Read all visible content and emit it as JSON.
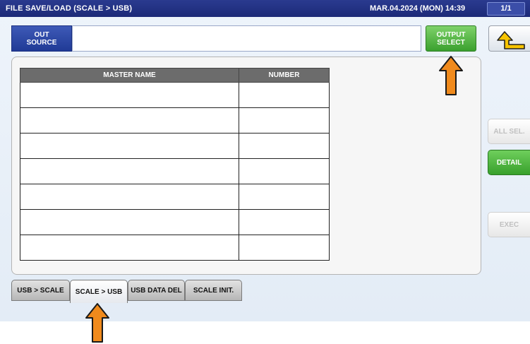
{
  "title_bar": {
    "title": "FILE SAVE/LOAD (SCALE > USB)",
    "datetime": "MAR.04.2024 (MON) 14:39",
    "page_indicator": "1/1"
  },
  "header": {
    "out_source_label": "OUT\nSOURCE",
    "out_source_value": "",
    "output_select_label": "OUTPUT\nSELECT",
    "back_icon": "return-arrow-icon"
  },
  "table": {
    "headers": [
      "MASTER NAME",
      "NUMBER"
    ],
    "rows": [
      [
        "",
        ""
      ],
      [
        "",
        ""
      ],
      [
        "",
        ""
      ],
      [
        "",
        ""
      ],
      [
        "",
        ""
      ],
      [
        "",
        ""
      ],
      [
        "",
        ""
      ]
    ]
  },
  "side_buttons": {
    "all_sel": "ALL SEL.",
    "detail": "DETAIL",
    "exec": "EXEC"
  },
  "tabs": [
    {
      "label": "USB > SCALE",
      "active": false
    },
    {
      "label": "SCALE > USB",
      "active": true
    },
    {
      "label": "USB DATA DEL",
      "active": false
    },
    {
      "label": "SCALE INIT.",
      "active": false
    }
  ],
  "colors": {
    "title_bar": "#1c2a78",
    "accent_green": "#3aa02e",
    "annotation_arrow": "#f08a1c",
    "table_header": "#6c6c6c"
  }
}
